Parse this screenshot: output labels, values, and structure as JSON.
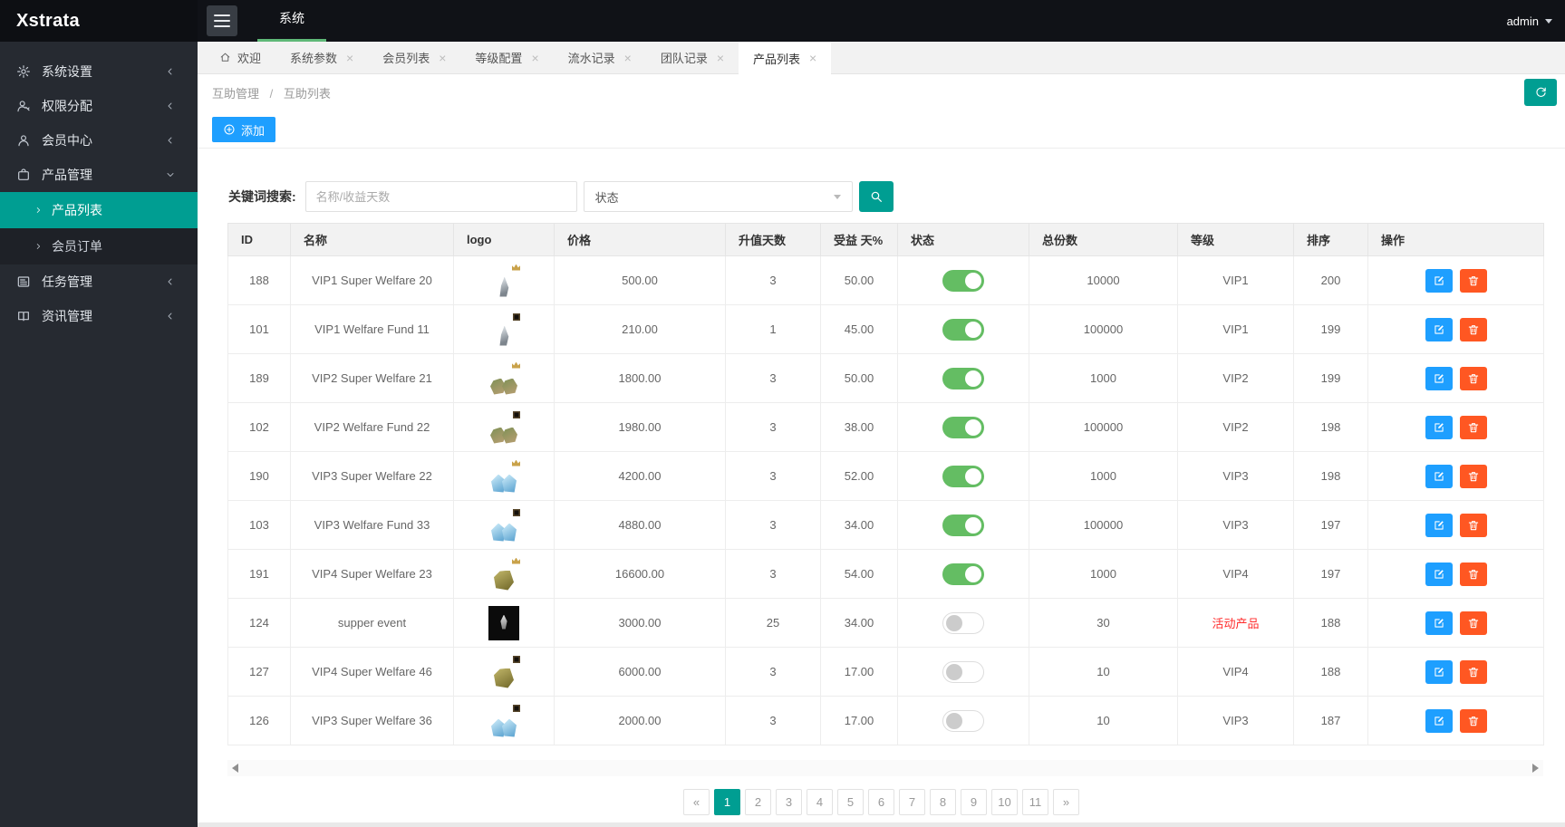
{
  "app": {
    "brand": "Xstrata",
    "user": "admin"
  },
  "topbar": {
    "menu_label": "系统"
  },
  "sidebar": {
    "items": [
      {
        "key": "system-settings",
        "label": "系统设置",
        "icon": "gear",
        "expanded": false
      },
      {
        "key": "permissions",
        "label": "权限分配",
        "icon": "user-key",
        "expanded": false
      },
      {
        "key": "member-center",
        "label": "会员中心",
        "icon": "user",
        "expanded": false
      },
      {
        "key": "product-management",
        "label": "产品管理",
        "icon": "product",
        "expanded": true,
        "children": [
          {
            "key": "product-list",
            "label": "产品列表",
            "active": true
          },
          {
            "key": "member-orders",
            "label": "会员订单",
            "active": false
          }
        ]
      },
      {
        "key": "task-management",
        "label": "任务管理",
        "icon": "tasks",
        "expanded": false
      },
      {
        "key": "news-management",
        "label": "资讯管理",
        "icon": "news",
        "expanded": false
      }
    ]
  },
  "tabs": [
    {
      "key": "welcome",
      "label": "欢迎",
      "icon": "home",
      "closable": false,
      "active": false
    },
    {
      "key": "system-params",
      "label": "系统参数",
      "closable": true,
      "active": false
    },
    {
      "key": "member-list",
      "label": "会员列表",
      "closable": true,
      "active": false
    },
    {
      "key": "level-config",
      "label": "等级配置",
      "closable": true,
      "active": false
    },
    {
      "key": "flow-records",
      "label": "流水记录",
      "closable": true,
      "active": false
    },
    {
      "key": "team-records",
      "label": "团队记录",
      "closable": true,
      "active": false
    },
    {
      "key": "product-list",
      "label": "产品列表",
      "closable": true,
      "active": true
    }
  ],
  "icons": {
    "close": "×"
  },
  "breadcrumb": {
    "parent": "互助管理",
    "separator": "/",
    "current": "互助列表"
  },
  "toolbar": {
    "add_label": "添加"
  },
  "search": {
    "label": "关键词搜索:",
    "keyword_placeholder": "名称/收益天数",
    "status_placeholder": "状态"
  },
  "table": {
    "columns": [
      {
        "key": "id",
        "label": "ID"
      },
      {
        "key": "name",
        "label": "名称"
      },
      {
        "key": "logo",
        "label": "logo"
      },
      {
        "key": "price",
        "label": "价格"
      },
      {
        "key": "days",
        "label": "升值天数"
      },
      {
        "key": "profit",
        "label": "受益 天%"
      },
      {
        "key": "status",
        "label": "状态"
      },
      {
        "key": "total",
        "label": "总份数"
      },
      {
        "key": "level",
        "label": "等级"
      },
      {
        "key": "sort",
        "label": "排序"
      },
      {
        "key": "actions",
        "label": "操作"
      }
    ],
    "rows": [
      {
        "id": "188",
        "name": "VIP1 Super Welfare 20",
        "logo": {
          "style": "grey-gem",
          "badge": "crown"
        },
        "price": "500.00",
        "days": "3",
        "profit": "50.00",
        "status": true,
        "total": "10000",
        "level": "VIP1",
        "level_red": false,
        "sort": "200"
      },
      {
        "id": "101",
        "name": "VIP1 Welfare Fund 11",
        "logo": {
          "style": "grey-gem",
          "badge": "tag"
        },
        "price": "210.00",
        "days": "1",
        "profit": "45.00",
        "status": true,
        "total": "100000",
        "level": "VIP1",
        "level_red": false,
        "sort": "199"
      },
      {
        "id": "189",
        "name": "VIP2 Super Welfare 21",
        "logo": {
          "style": "green-rocks",
          "badge": "crown"
        },
        "price": "1800.00",
        "days": "3",
        "profit": "50.00",
        "status": true,
        "total": "1000",
        "level": "VIP2",
        "level_red": false,
        "sort": "199"
      },
      {
        "id": "102",
        "name": "VIP2 Welfare Fund 22",
        "logo": {
          "style": "green-rocks",
          "badge": "tag"
        },
        "price": "1980.00",
        "days": "3",
        "profit": "38.00",
        "status": true,
        "total": "100000",
        "level": "VIP2",
        "level_red": false,
        "sort": "198"
      },
      {
        "id": "190",
        "name": "VIP3 Super Welfare 22",
        "logo": {
          "style": "blue-gems",
          "badge": "crown"
        },
        "price": "4200.00",
        "days": "3",
        "profit": "52.00",
        "status": true,
        "total": "1000",
        "level": "VIP3",
        "level_red": false,
        "sort": "198"
      },
      {
        "id": "103",
        "name": "VIP3 Welfare Fund 33",
        "logo": {
          "style": "blue-gems",
          "badge": "tag"
        },
        "price": "4880.00",
        "days": "3",
        "profit": "34.00",
        "status": true,
        "total": "100000",
        "level": "VIP3",
        "level_red": false,
        "sort": "197"
      },
      {
        "id": "191",
        "name": "VIP4 Super Welfare 23",
        "logo": {
          "style": "olive-rock",
          "badge": "crown"
        },
        "price": "16600.00",
        "days": "3",
        "profit": "54.00",
        "status": true,
        "total": "1000",
        "level": "VIP4",
        "level_red": false,
        "sort": "197"
      },
      {
        "id": "124",
        "name": "supper event",
        "logo": {
          "style": "dark-gem",
          "badge": ""
        },
        "price": "3000.00",
        "days": "25",
        "profit": "34.00",
        "status": false,
        "total": "30",
        "level": "活动产品",
        "level_red": true,
        "sort": "188"
      },
      {
        "id": "127",
        "name": "VIP4 Super Welfare 46",
        "logo": {
          "style": "olive-rock",
          "badge": "tag"
        },
        "price": "6000.00",
        "days": "3",
        "profit": "17.00",
        "status": false,
        "total": "10",
        "level": "VIP4",
        "level_red": false,
        "sort": "188"
      },
      {
        "id": "126",
        "name": "VIP3 Super Welfare 36",
        "logo": {
          "style": "blue-gems",
          "badge": "tag"
        },
        "price": "2000.00",
        "days": "3",
        "profit": "17.00",
        "status": false,
        "total": "10",
        "level": "VIP3",
        "level_red": false,
        "sort": "187"
      }
    ]
  },
  "pagination": {
    "prev": "«",
    "next": "»",
    "pages": [
      "1",
      "2",
      "3",
      "4",
      "5",
      "6",
      "7",
      "8",
      "9",
      "10",
      "11"
    ],
    "active": "1"
  },
  "colors": {
    "accent_teal": "#009e92",
    "top_green": "#5FB878",
    "primary_blue": "#1E9FFF",
    "danger_orange": "#FF5722",
    "toggle_on_green": "#64bd63",
    "level_red": "#ff2b2b"
  }
}
